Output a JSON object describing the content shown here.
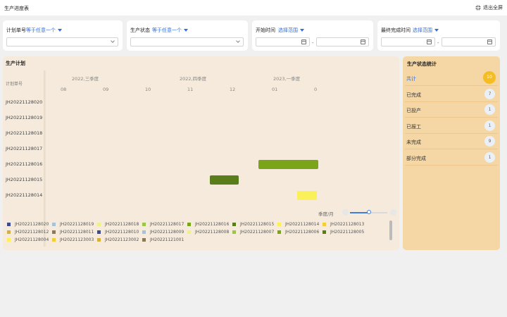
{
  "app": {
    "title": "生产进度表",
    "exit_fullscreen": "退出全屏"
  },
  "filters": {
    "plan_no": {
      "label": "计划单号",
      "mode": "等于任意一个"
    },
    "status": {
      "label": "生产状态",
      "mode": "等于任意一个"
    },
    "start_time": {
      "label": "开始时间",
      "mode": "选择范围",
      "separator": "-"
    },
    "finish_time": {
      "label": "最终完成时间",
      "mode": "选择范围",
      "separator": "-"
    }
  },
  "plan": {
    "title": "生产计划",
    "column_header": "计划单号",
    "quarters": [
      "2022,三季度",
      "2022,四季度",
      "2023,一季度"
    ],
    "months": [
      "08",
      "09",
      "10",
      "11",
      "12",
      "01",
      "0"
    ],
    "rows": [
      {
        "id": "JH20221128020"
      },
      {
        "id": "JH20221128019"
      },
      {
        "id": "JH20221128018"
      },
      {
        "id": "JH20221128017"
      },
      {
        "id": "JH20221128016",
        "bar": {
          "start": "2022-12-20",
          "end": "2023-02-01",
          "color": "#7aa51a"
        }
      },
      {
        "id": "JH20221128015",
        "bar": {
          "start": "2022-11-15",
          "end": "2022-12-06",
          "color": "#587d1a"
        }
      },
      {
        "id": "JH20221128014",
        "bar": {
          "start": "2023-01-17",
          "end": "2023-01-31",
          "color": "#f9f05a"
        }
      }
    ],
    "scale_label": "季度/月",
    "zoom_level": 0.5
  },
  "legend": [
    {
      "label": "JH20221128020",
      "color": "#3d4a8c"
    },
    {
      "label": "JH20221128019",
      "color": "#a8c2d8"
    },
    {
      "label": "JH20221128018",
      "color": "#eef08a"
    },
    {
      "label": "JH20221128017",
      "color": "#9cc64a"
    },
    {
      "label": "JH20221128016",
      "color": "#7aa51a"
    },
    {
      "label": "JH20221128015",
      "color": "#587d1a"
    },
    {
      "label": "JH20221128014",
      "color": "#f9f05a"
    },
    {
      "label": "JH20221128013",
      "color": "#f2cf3a"
    },
    {
      "label": "JH20221128012",
      "color": "#d4b040"
    },
    {
      "label": "JH20221128011",
      "color": "#8a7a5a"
    },
    {
      "label": "JH20221128010",
      "color": "#3d4a8c"
    },
    {
      "label": "JH20221128009",
      "color": "#a8c2d8"
    },
    {
      "label": "JH20221128008",
      "color": "#eef08a"
    },
    {
      "label": "JH20221128007",
      "color": "#9cc64a"
    },
    {
      "label": "JH20221128006",
      "color": "#7aa51a"
    },
    {
      "label": "JH20221128005",
      "color": "#587d1a"
    },
    {
      "label": "JH20221128004",
      "color": "#f9f05a"
    },
    {
      "label": "JH20221123003",
      "color": "#f2cf3a"
    },
    {
      "label": "JH20221123002",
      "color": "#d4b040"
    },
    {
      "label": "JH20221121001",
      "color": "#8a7a5a"
    }
  ],
  "stats": {
    "title": "生产状态统计",
    "items": [
      {
        "label": "共计",
        "count": "10"
      },
      {
        "label": "已完成",
        "count": "7"
      },
      {
        "label": "已投产",
        "count": "1"
      },
      {
        "label": "已报工",
        "count": "1"
      },
      {
        "label": "未完成",
        "count": "9"
      },
      {
        "label": "部分完成",
        "count": "1"
      }
    ]
  }
}
